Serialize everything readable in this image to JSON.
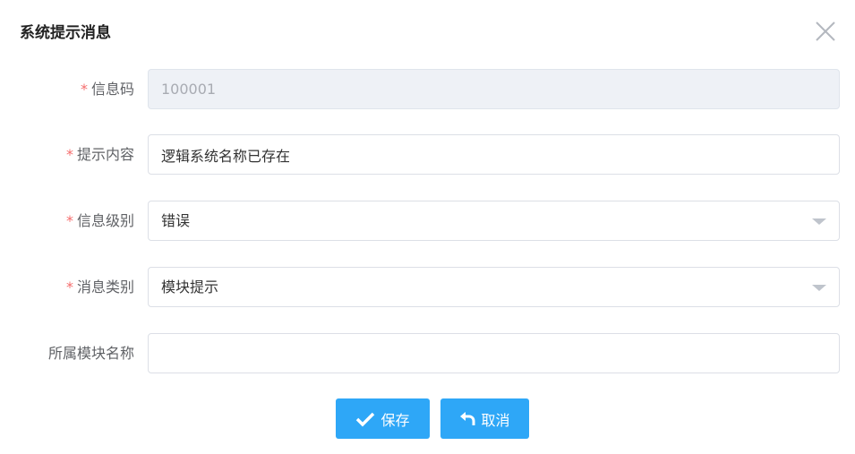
{
  "dialog": {
    "title": "系统提示消息",
    "close_icon": "close-icon"
  },
  "form": {
    "required_mark": "*",
    "info_code": {
      "label": "信息码",
      "value": "100001",
      "disabled": true
    },
    "prompt_content": {
      "label": "提示内容",
      "value": "逻辑系统名称已存在"
    },
    "info_level": {
      "label": "信息级别",
      "value": "错误"
    },
    "message_type": {
      "label": "消息类别",
      "value": "模块提示"
    },
    "module_name": {
      "label": "所属模块名称",
      "value": ""
    }
  },
  "buttons": {
    "save": {
      "label": "保存",
      "icon": "check-icon"
    },
    "cancel": {
      "label": "取消",
      "icon": "undo-icon"
    }
  },
  "colors": {
    "primary": "#2ea7f7",
    "required": "#f56c6c"
  }
}
